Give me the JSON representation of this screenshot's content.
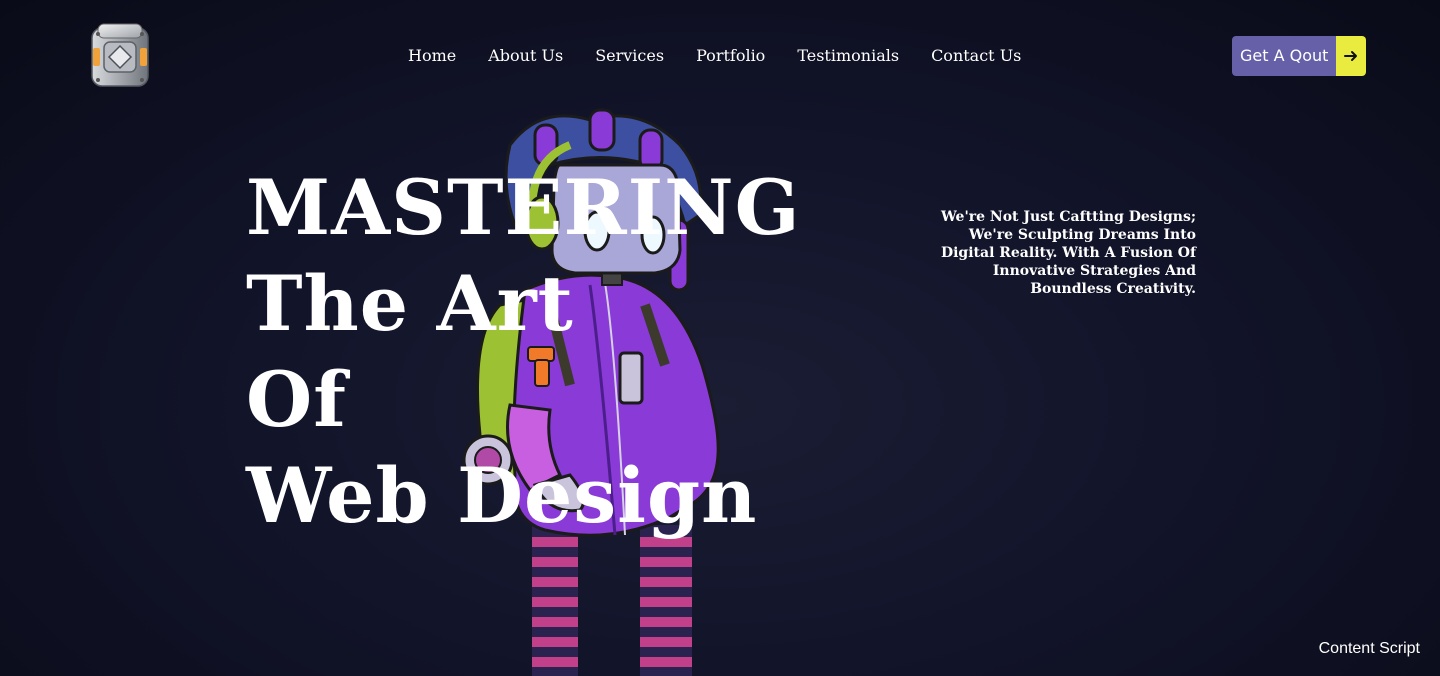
{
  "header": {
    "logo_icon": "metal-cube-logo-icon",
    "nav": [
      {
        "label": "Home"
      },
      {
        "label": "About Us"
      },
      {
        "label": "Services"
      },
      {
        "label": "Portfolio"
      },
      {
        "label": "Testimonials"
      },
      {
        "label": "Contact Us"
      }
    ],
    "cta": {
      "label": "Get A Qout",
      "icon": "arrow-right-icon",
      "label_color": "#6560a8",
      "arrow_color": "#e9ec3f"
    }
  },
  "hero": {
    "title_lines": [
      "MASTERING",
      "The Art",
      "Of",
      "Web Design"
    ],
    "tagline": "We're Not Just Caftting Designs; We're Sculpting Dreams Into Digital Reality. With A Fusion Of Innovative Strategies And Boundless Creativity.",
    "illustration": "robot-character-illustration"
  },
  "overlay": {
    "content_script": "Content Script"
  },
  "colors": {
    "background": "#0f1124",
    "text": "#ffffff"
  }
}
